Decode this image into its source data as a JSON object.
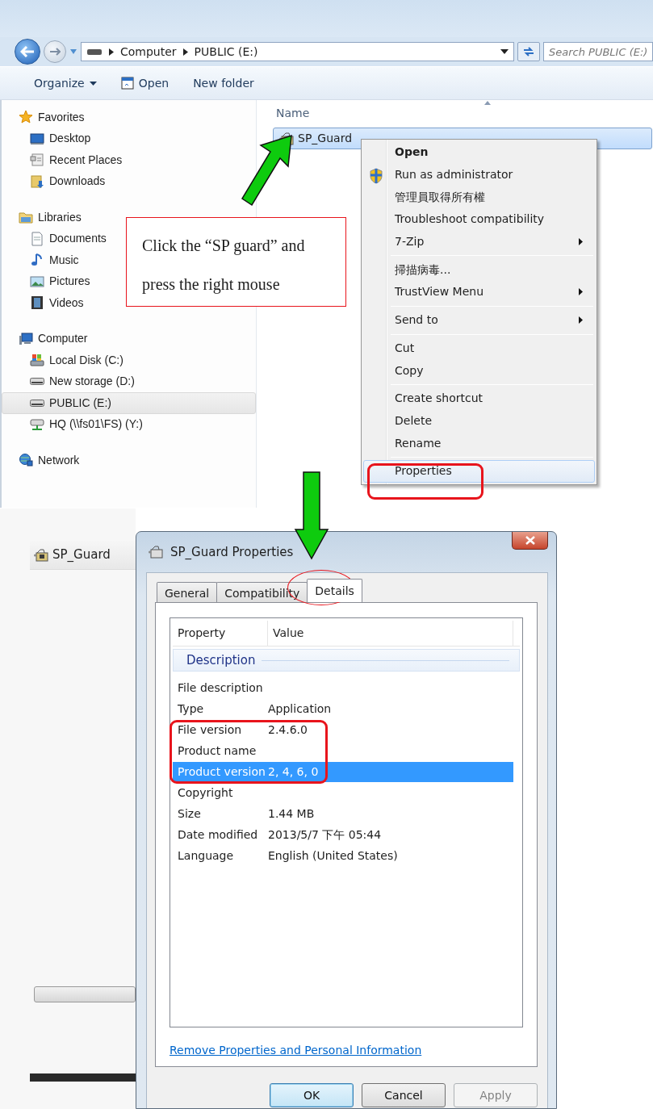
{
  "explorer": {
    "address": {
      "segments": [
        "Computer",
        "PUBLIC (E:)"
      ]
    },
    "search": {
      "placeholder": "Search PUBLIC (E:)"
    },
    "toolbar": [
      {
        "label": "Organize",
        "kind": "menu"
      },
      {
        "label": "Open",
        "kind": "icon"
      },
      {
        "label": "New folder",
        "kind": "plain"
      }
    ],
    "sidebar": {
      "groups": [
        {
          "label": "Favorites",
          "kind": "star",
          "selected": false,
          "children": [
            {
              "label": "Desktop",
              "kind": "desktop",
              "selected": false
            },
            {
              "label": "Recent Places",
              "kind": "recent",
              "selected": false
            },
            {
              "label": "Downloads",
              "kind": "downloads",
              "selected": false
            }
          ]
        },
        {
          "label": "Libraries",
          "kind": "library",
          "selected": false,
          "children": [
            {
              "label": "Documents",
              "kind": "document",
              "selected": false
            },
            {
              "label": "Music",
              "kind": "music",
              "selected": false
            },
            {
              "label": "Pictures",
              "kind": "pictures",
              "selected": false
            },
            {
              "label": "Videos",
              "kind": "videos",
              "selected": false
            }
          ]
        },
        {
          "label": "Computer",
          "kind": "computer",
          "selected": false,
          "children": [
            {
              "label": "Local Disk (C:)",
              "kind": "disk",
              "selected": false
            },
            {
              "label": "New storage (D:)",
              "kind": "drive",
              "selected": false
            },
            {
              "label": "PUBLIC (E:)",
              "kind": "drive",
              "selected": true
            },
            {
              "label": "HQ (\\\\fs01\\FS) (Y:)",
              "kind": "network-drive",
              "selected": false
            }
          ]
        },
        {
          "label": "Network",
          "kind": "network",
          "selected": false
        }
      ]
    },
    "files": {
      "column": "Name",
      "items": [
        {
          "label": "SP_Guard",
          "selected": true
        }
      ]
    },
    "context_menu": {
      "groups": [
        [
          {
            "label": "Open",
            "kind": "plain",
            "bold": true,
            "submenu": false,
            "highlighted": false
          },
          {
            "label": "Run as administrator",
            "kind": "shield",
            "bold": false,
            "submenu": false,
            "highlighted": false
          },
          {
            "label": "管理員取得所有權",
            "kind": "plain",
            "bold": false,
            "submenu": false,
            "highlighted": false
          },
          {
            "label": "Troubleshoot compatibility",
            "kind": "plain",
            "bold": false,
            "submenu": false,
            "highlighted": false
          },
          {
            "label": "7-Zip",
            "kind": "plain",
            "bold": false,
            "submenu": true,
            "highlighted": false
          }
        ],
        [
          {
            "label": "掃描病毒...",
            "kind": "plain",
            "bold": false,
            "submenu": false,
            "highlighted": false
          },
          {
            "label": "TrustView Menu",
            "kind": "plain",
            "bold": false,
            "submenu": true,
            "highlighted": false
          }
        ],
        [
          {
            "label": "Send to",
            "kind": "plain",
            "bold": false,
            "submenu": true,
            "highlighted": false
          }
        ],
        [
          {
            "label": "Cut",
            "kind": "plain",
            "bold": false,
            "submenu": false,
            "highlighted": false
          },
          {
            "label": "Copy",
            "kind": "plain",
            "bold": false,
            "submenu": false,
            "highlighted": false
          }
        ],
        [
          {
            "label": "Create shortcut",
            "kind": "plain",
            "bold": false,
            "submenu": false,
            "highlighted": false
          },
          {
            "label": "Delete",
            "kind": "plain",
            "bold": false,
            "submenu": false,
            "highlighted": false
          },
          {
            "label": "Rename",
            "kind": "plain",
            "bold": false,
            "submenu": false,
            "highlighted": false
          }
        ],
        [
          {
            "label": "Properties",
            "kind": "plain",
            "bold": false,
            "submenu": false,
            "highlighted": true
          }
        ]
      ]
    }
  },
  "callout": {
    "text": "Click the “SP guard” and press the right mouse"
  },
  "background_file": {
    "label": "SP_Guard"
  },
  "dialog": {
    "title": "SP_Guard Properties",
    "tabs": [
      {
        "label": "General",
        "selected": false
      },
      {
        "label": "Compatibility",
        "selected": false
      },
      {
        "label": "Details",
        "selected": true
      }
    ],
    "columns": [
      "Property",
      "Value"
    ],
    "group": "Description",
    "rows": [
      {
        "property": "File description",
        "selected": false
      },
      {
        "property": "Type",
        "value": "Application",
        "selected": false
      },
      {
        "property": "File version",
        "value": "2.4.6.0",
        "selected": false
      },
      {
        "property": "Product name",
        "selected": false
      },
      {
        "property": "Product version",
        "value": "2, 4, 6, 0",
        "selected": true
      },
      {
        "property": "Copyright",
        "selected": false
      },
      {
        "property": "Size",
        "value": "1.44 MB",
        "selected": false
      },
      {
        "property": "Date modified",
        "value": "2013/5/7 下午 05:44",
        "selected": false
      },
      {
        "property": "Language",
        "value": "English (United States)",
        "selected": false
      }
    ],
    "link": "Remove Properties and Personal Information",
    "buttons": [
      {
        "label": "OK",
        "default": true,
        "disabled": false
      },
      {
        "label": "Cancel",
        "default": false,
        "disabled": false
      },
      {
        "label": "Apply",
        "default": false,
        "disabled": true
      }
    ]
  }
}
